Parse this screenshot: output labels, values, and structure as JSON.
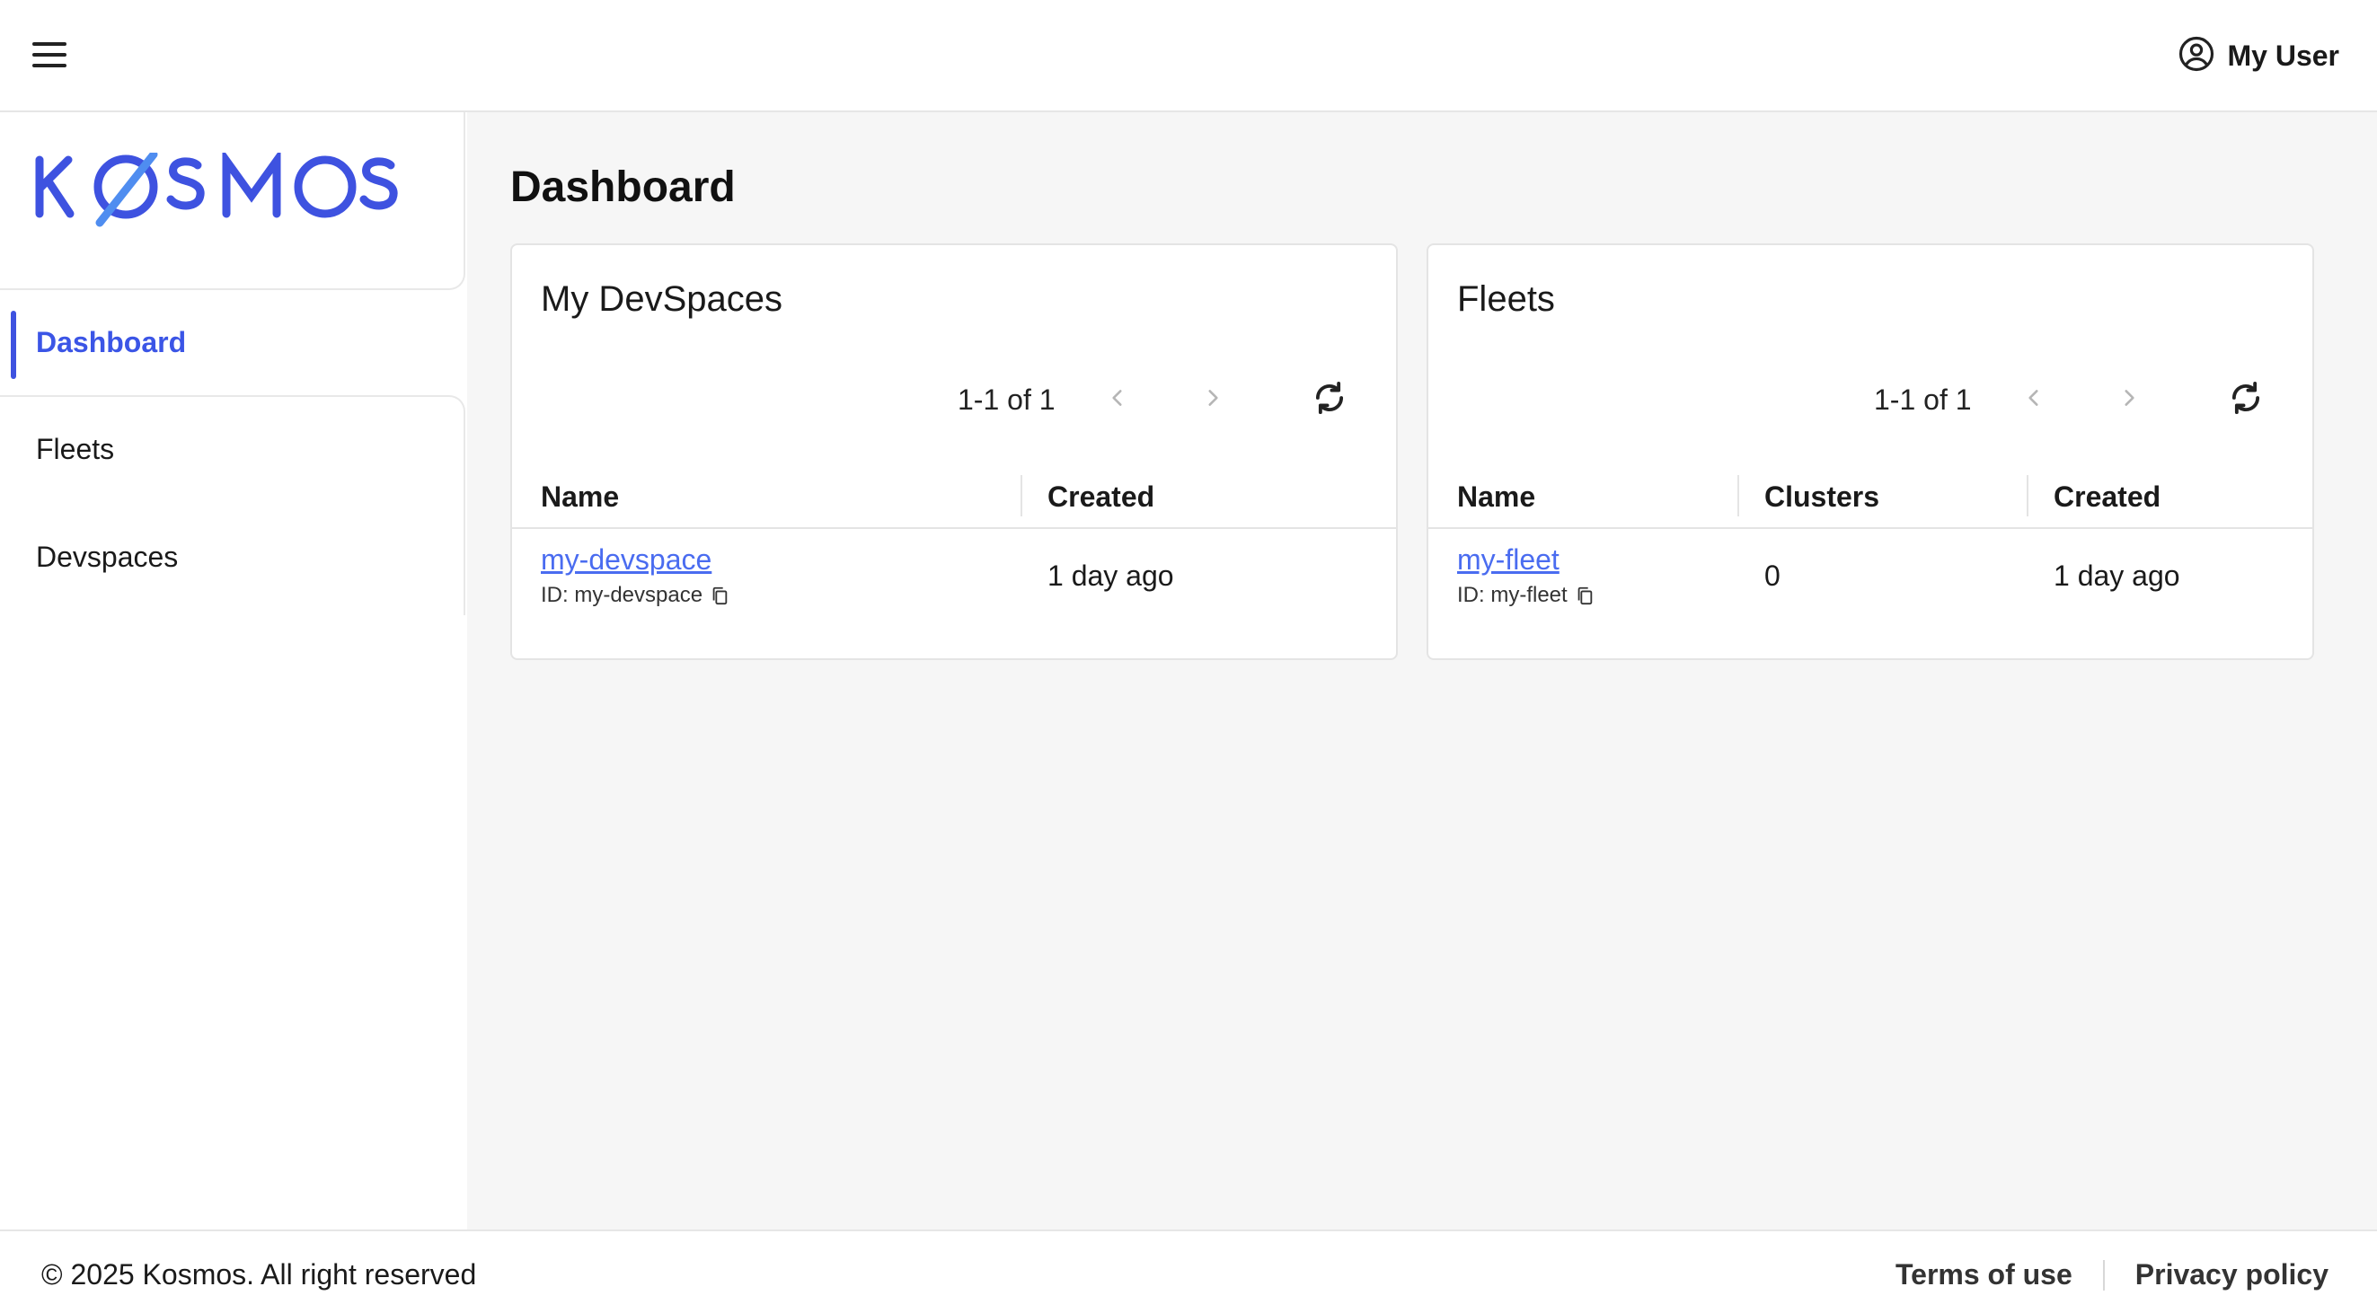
{
  "header": {
    "menu_icon": "hamburger-menu-icon",
    "user_icon": "account-circle-icon",
    "user_label": "My User"
  },
  "brand": {
    "logo_text": "KØSMOS",
    "color": "#3e52e0"
  },
  "sidebar": {
    "items": [
      {
        "label": "Dashboard",
        "active": true
      },
      {
        "label": "Fleets",
        "active": false
      },
      {
        "label": "Devspaces",
        "active": false
      }
    ]
  },
  "main": {
    "title": "Dashboard",
    "devspaces": {
      "title": "My DevSpaces",
      "pagination": "1-1 of 1",
      "columns": [
        "Name",
        "Created"
      ],
      "rows": [
        {
          "name": "my-devspace",
          "id": "ID: my-devspace",
          "created": "1 day ago"
        }
      ]
    },
    "fleets": {
      "title": "Fleets",
      "pagination": "1-1 of 1",
      "columns": [
        "Name",
        "Clusters",
        "Created"
      ],
      "rows": [
        {
          "name": "my-fleet",
          "id": "ID: my-fleet",
          "clusters": "0",
          "created": "1 day ago"
        }
      ]
    }
  },
  "footer": {
    "copyright": "© 2025 Kosmos. All right reserved",
    "terms": "Terms of use",
    "privacy": "Privacy policy"
  },
  "colors": {
    "accent": "#3b55e6",
    "link": "#4a6cf0",
    "background": "#f6f6f6"
  }
}
